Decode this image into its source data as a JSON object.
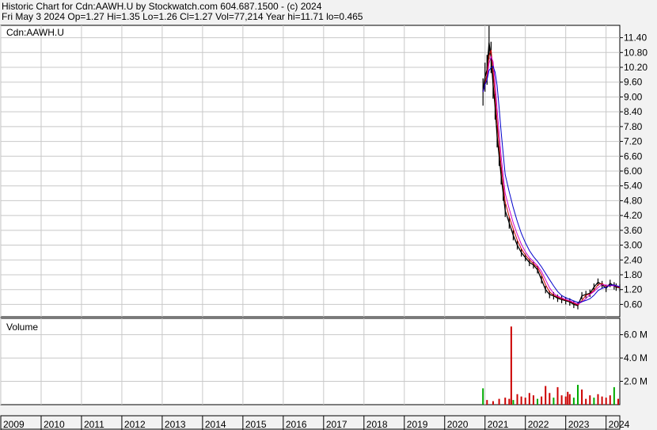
{
  "header": {
    "line1": "Historic Chart for Cdn:AAWH.U by Stockwatch.com 604.687.1500 - (c) 2024",
    "line2": "Fri May  3 2024   Op=1.27  Hi=1.35  Lo=1.26  Cl=1.27  Vol=77,214  Year hi=11.71  lo=0.465"
  },
  "colors": {
    "background": "#f2f2f2",
    "grid": "#c8c8c8",
    "price": "#000000",
    "ma_short": "#cc0000",
    "ma_mid": "#cc00cc",
    "ma_long": "#0000cc",
    "volume_up": "#00aa00",
    "volume_down": "#cc0000"
  },
  "chart_data": [
    {
      "type": "line",
      "label": "Cdn:AAWH.U",
      "x_ticks": [
        "2009",
        "2010",
        "2011",
        "2012",
        "2013",
        "2014",
        "2015",
        "2016",
        "2017",
        "2018",
        "2019",
        "2020",
        "2021",
        "2022",
        "2023",
        "2024"
      ],
      "y_ticks": [
        "11.40",
        "10.80",
        "10.20",
        "9.60",
        "9.00",
        "8.40",
        "7.80",
        "7.20",
        "6.60",
        "6.00",
        "5.40",
        "4.80",
        "4.20",
        "3.60",
        "3.00",
        "2.40",
        "1.80",
        "1.20",
        "0.60"
      ],
      "ylim": [
        0.1,
        11.9
      ],
      "grid": true,
      "series": [
        {
          "x": [
            2020.95,
            2021.0,
            2021.05,
            2021.1,
            2021.15,
            2021.2,
            2021.25,
            2021.3,
            2021.35,
            2021.4,
            2021.45,
            2021.5,
            2021.6,
            2021.7,
            2021.8,
            2021.9,
            2022.0,
            2022.1,
            2022.2,
            2022.3,
            2022.4,
            2022.5,
            2022.6,
            2022.7,
            2022.8,
            2022.9,
            2023.0,
            2023.1,
            2023.2,
            2023.3,
            2023.4,
            2023.5,
            2023.6,
            2023.7,
            2023.8,
            2023.9,
            2024.0,
            2024.1,
            2024.2,
            2024.25,
            2024.34
          ],
          "y": [
            9.2,
            9.8,
            10.1,
            11.2,
            10.6,
            9.5,
            8.6,
            7.4,
            6.6,
            5.8,
            5.1,
            4.4,
            3.9,
            3.4,
            3.0,
            2.7,
            2.5,
            2.3,
            2.2,
            2.0,
            1.6,
            1.2,
            1.0,
            0.95,
            0.85,
            0.8,
            0.75,
            0.7,
            0.6,
            0.55,
            0.95,
            1.0,
            1.05,
            1.3,
            1.5,
            1.4,
            1.25,
            1.45,
            1.35,
            1.3,
            1.27
          ]
        }
      ]
    },
    {
      "type": "bar",
      "label": "Volume",
      "y_ticks": [
        "6.0 M",
        "4.0 M",
        "2.0 M"
      ],
      "ylim": [
        0,
        7.4
      ],
      "series": [
        {
          "x": [
            2020.95,
            2021.05,
            2021.2,
            2021.35,
            2021.5,
            2021.6,
            2021.65,
            2021.7,
            2021.8,
            2021.9,
            2022.0,
            2022.1,
            2022.2,
            2022.3,
            2022.4,
            2022.5,
            2022.6,
            2022.7,
            2022.8,
            2022.9,
            2023.0,
            2023.05,
            2023.1,
            2023.2,
            2023.3,
            2023.4,
            2023.5,
            2023.6,
            2023.7,
            2023.8,
            2023.9,
            2024.0,
            2024.1,
            2024.2,
            2024.3
          ],
          "y": [
            1.4,
            0.4,
            0.3,
            0.5,
            0.6,
            0.5,
            6.7,
            0.4,
            0.9,
            0.7,
            0.6,
            1.0,
            0.8,
            0.5,
            0.7,
            1.6,
            1.0,
            0.6,
            1.5,
            0.8,
            0.7,
            1.1,
            0.9,
            0.6,
            1.7,
            1.3,
            0.5,
            0.8,
            0.6,
            0.9,
            0.7,
            0.6,
            0.8,
            1.5,
            0.5
          ],
          "up": [
            true,
            false,
            false,
            false,
            false,
            false,
            false,
            true,
            false,
            false,
            false,
            false,
            false,
            true,
            false,
            false,
            false,
            true,
            false,
            false,
            false,
            false,
            false,
            true,
            true,
            false,
            false,
            false,
            true,
            false,
            false,
            false,
            false,
            true,
            false
          ]
        }
      ]
    }
  ]
}
